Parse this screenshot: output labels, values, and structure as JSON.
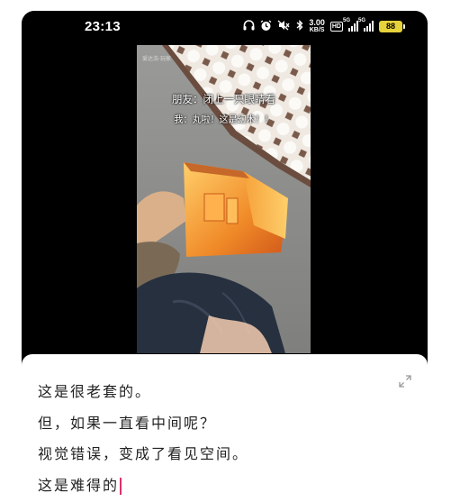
{
  "status_bar": {
    "time": "23:13",
    "net_speed_value": "3.00",
    "net_speed_unit": "KB/S",
    "hd_label": "HD",
    "signal_1_label": "5G",
    "signal_2_label": "5G",
    "battery_level": "88",
    "icons": [
      "headphones-icon",
      "alarm-icon",
      "mute-icon",
      "bluetooth-icon"
    ]
  },
  "video": {
    "watermark": "爱达浩·玩家",
    "caption_line1": "朋友：闭上一只眼睛看",
    "caption_line2": "我：丸啦！这是幻术！！"
  },
  "editor": {
    "lines": [
      "这是很老套的。",
      "但，如果一直看中间呢？",
      "视觉错误，变成了看见空间。",
      "这是难得的"
    ]
  },
  "colors": {
    "caret": "#e0316b",
    "battery": "#e6d23a",
    "lamp": "#f08a28"
  }
}
